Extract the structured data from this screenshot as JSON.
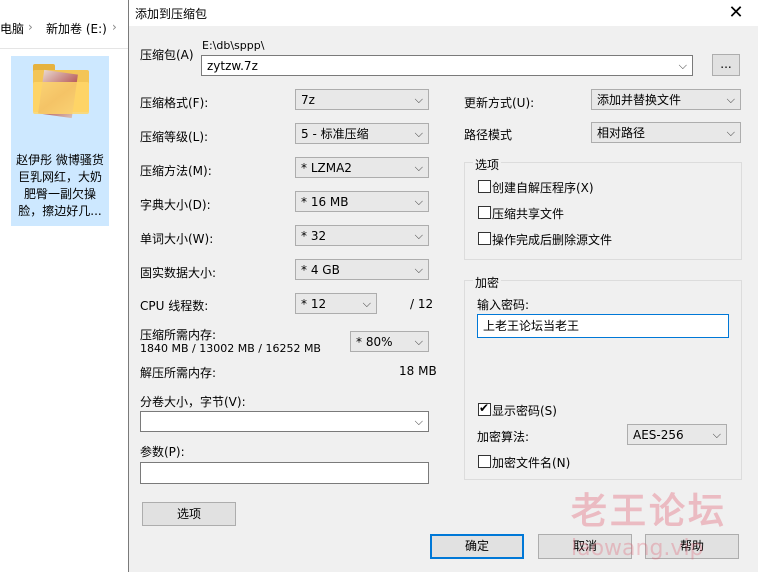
{
  "explorer": {
    "crumb_pc": "电脑",
    "crumb_volume": "新加卷 (E:)",
    "file_caption": "赵伊彤 微博骚货巨乳网红，大奶肥臀一副欠操脸，擦边好几..."
  },
  "dialog": {
    "title": "添加到压缩包",
    "close_symbol": "✕",
    "archive": {
      "label": "压缩包(A)",
      "path": "E:\\db\\sppp\\",
      "value": "zytzw.7z",
      "browse_label": "..."
    },
    "format": {
      "label": "压缩格式(F):",
      "value": "7z"
    },
    "level": {
      "label": "压缩等级(L):",
      "value": "5 - 标准压缩"
    },
    "method": {
      "label": "压缩方法(M):",
      "value": "* LZMA2"
    },
    "dict": {
      "label": "字典大小(D):",
      "value": "* 16 MB"
    },
    "word": {
      "label": "单词大小(W):",
      "value": "* 32"
    },
    "solid": {
      "label": "固实数据大小:",
      "value": "* 4 GB"
    },
    "cpu": {
      "label": "CPU 线程数:",
      "value": "* 12",
      "max": "/ 12"
    },
    "memory_compress": {
      "label": "压缩所需内存:",
      "value": "1840 MB / 13002 MB / 16252 MB",
      "percent": "* 80%"
    },
    "memory_decompress": {
      "label": "解压所需内存:",
      "value": "18 MB"
    },
    "split": {
      "label": "分卷大小，字节(V):",
      "value": ""
    },
    "params": {
      "label": "参数(P):",
      "value": ""
    },
    "options_button": "选项",
    "update": {
      "label": "更新方式(U):",
      "value": "添加并替换文件"
    },
    "path_mode": {
      "label": "路径模式",
      "value": "相对路径"
    },
    "options_group": {
      "title": "选项",
      "sfx": {
        "label": "创建自解压程序(X)",
        "checked": false
      },
      "shared": {
        "label": "压缩共享文件",
        "checked": false
      },
      "delete": {
        "label": "操作完成后删除源文件",
        "checked": false
      }
    },
    "encryption": {
      "title": "加密",
      "password_label": "输入密码:",
      "password_value": "上老王论坛当老王",
      "show_password": {
        "label": "显示密码(S)",
        "checked": true
      },
      "method_label": "加密算法:",
      "method_value": "AES-256",
      "encrypt_names": {
        "label": "加密文件名(N)",
        "checked": false
      }
    },
    "ok": "确定",
    "cancel": "取消",
    "help": "帮助",
    "chevron_symbol": "⌵"
  },
  "watermark": {
    "main": "老王论坛",
    "sub": "laowang.vip"
  }
}
